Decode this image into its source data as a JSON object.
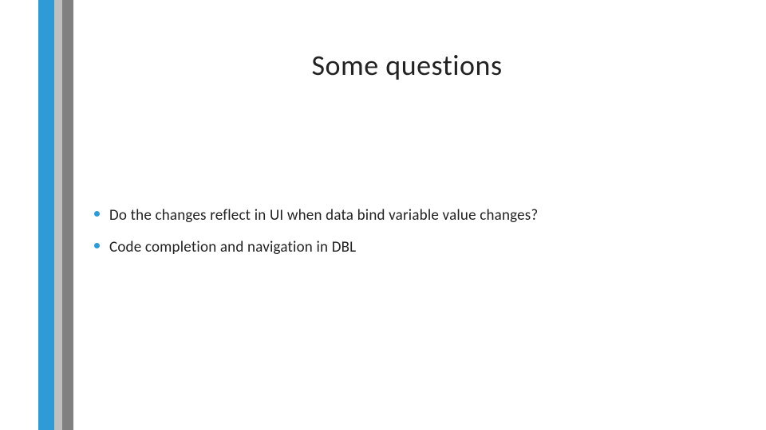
{
  "accent_color": "#2E9BD6",
  "title": "Some questions",
  "bullets": [
    {
      "text": "Do the changes reflect in UI when data bind variable value changes?"
    },
    {
      "text": "Code completion and navigation in DBL"
    }
  ]
}
